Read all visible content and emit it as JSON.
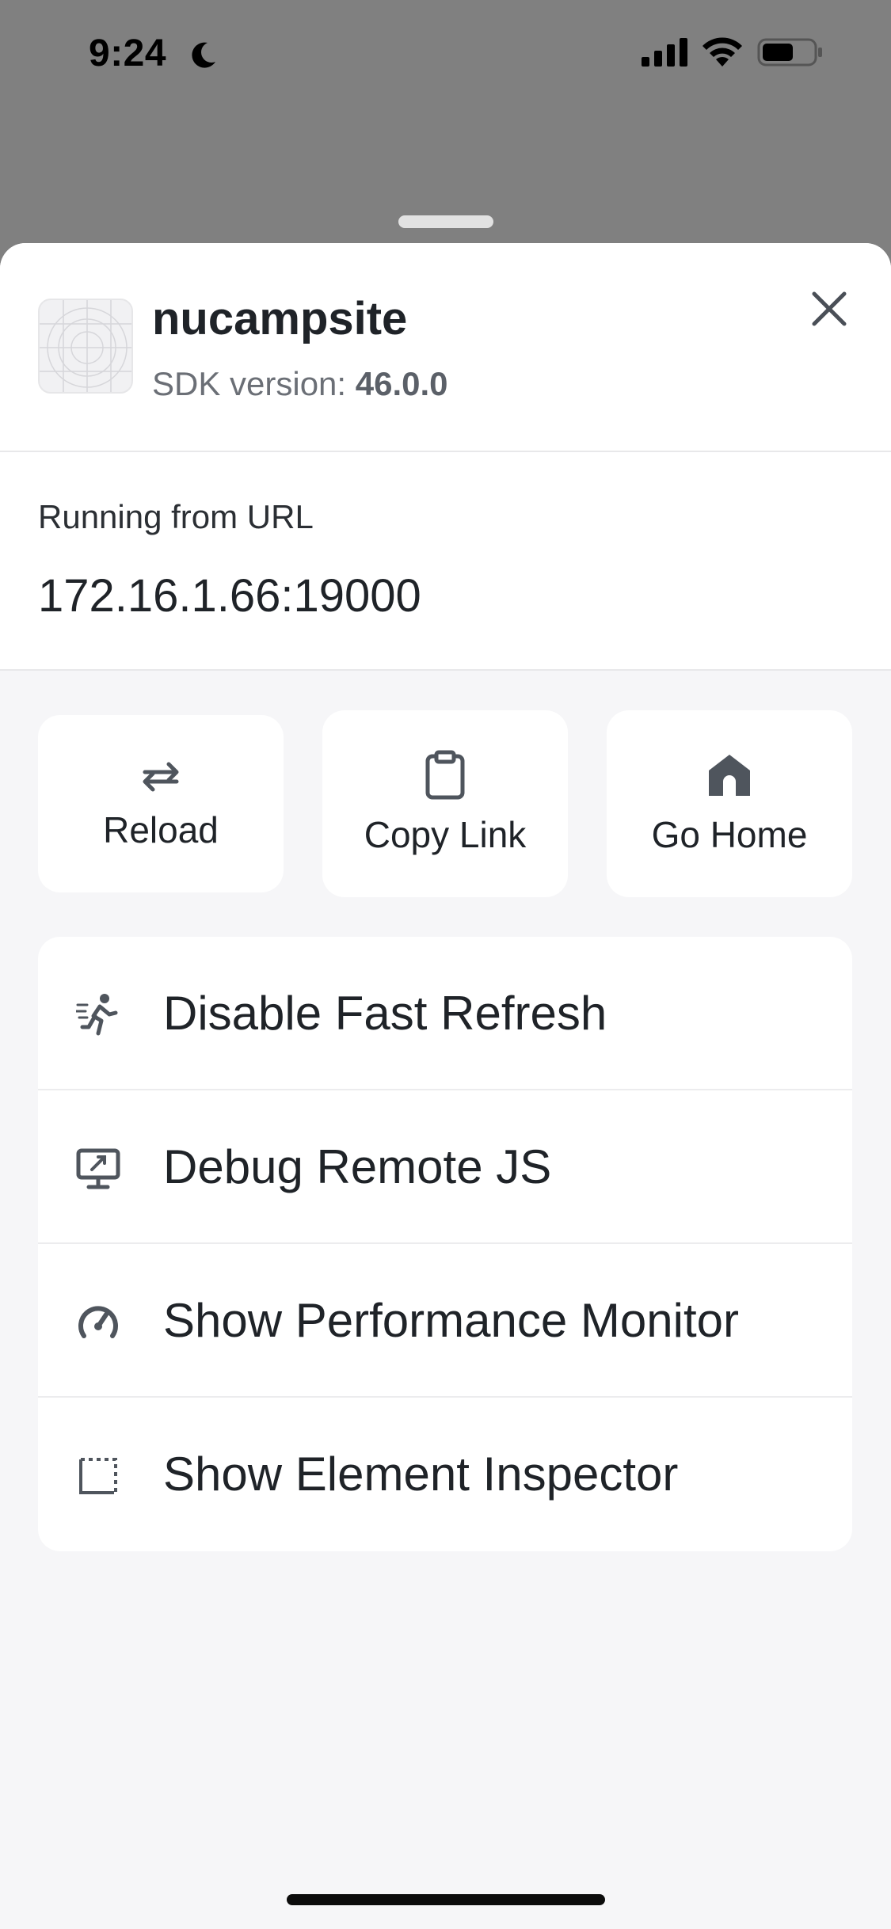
{
  "status_bar": {
    "time": "9:24",
    "icons": [
      "moon-icon",
      "cellular-signal-icon",
      "wifi-icon",
      "battery-icon"
    ]
  },
  "header": {
    "app_name": "nucampsite",
    "sdk_label": "SDK version:",
    "sdk_version": "46.0.0"
  },
  "url_section": {
    "label": "Running from URL",
    "url": "172.16.1.66:19000"
  },
  "actions": [
    {
      "label": "Reload",
      "icon": "reload-icon"
    },
    {
      "label": "Copy Link",
      "icon": "clipboard-icon"
    },
    {
      "label": "Go Home",
      "icon": "home-icon"
    }
  ],
  "menu": [
    {
      "label": "Disable Fast Refresh",
      "icon": "running-person-icon"
    },
    {
      "label": "Debug Remote JS",
      "icon": "monitor-debug-icon"
    },
    {
      "label": "Show Performance Monitor",
      "icon": "speedometer-icon"
    },
    {
      "label": "Show Element Inspector",
      "icon": "inspector-frame-icon"
    }
  ],
  "colors": {
    "backdrop": "#808080",
    "sheet_background": "#f6f6f8",
    "card": "#ffffff",
    "icon": "#5b6068",
    "text": "#1f2328"
  }
}
